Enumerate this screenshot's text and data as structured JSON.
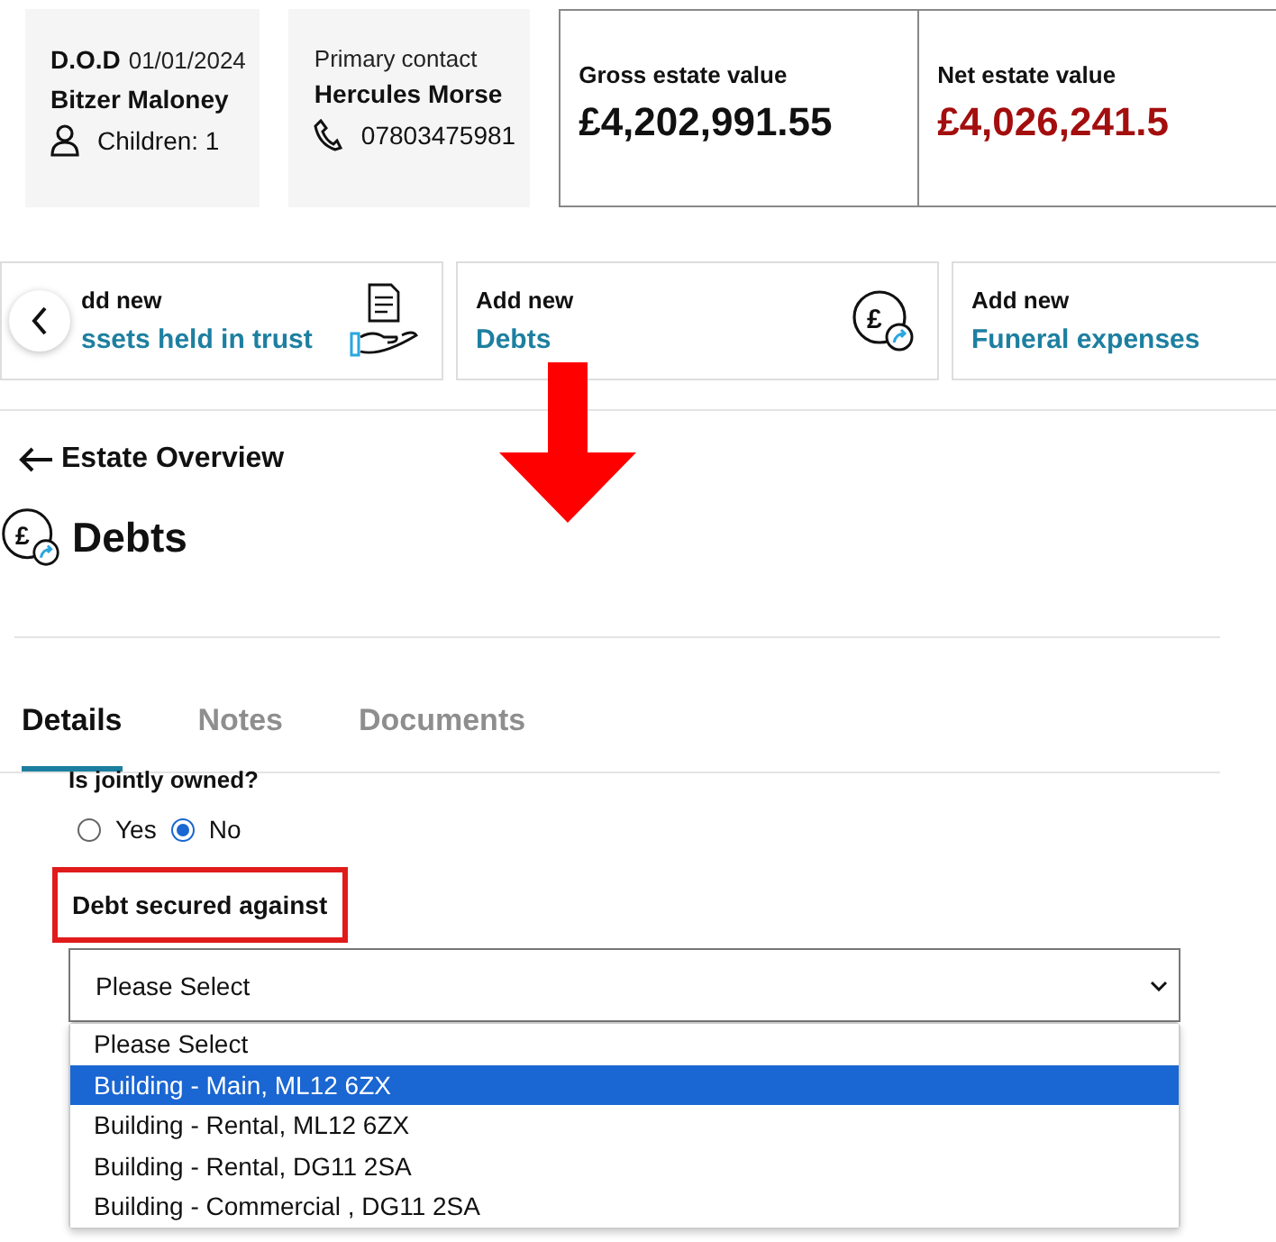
{
  "summary_cards": [
    {
      "kind": "person",
      "label": "D.O.D",
      "date": "01/01/2024",
      "name": "Bitzer Maloney",
      "detail": "Children: 1"
    },
    {
      "kind": "contact",
      "label": "Primary contact",
      "name": "Hercules Morse",
      "detail": "07803475981"
    }
  ],
  "value_cards": [
    {
      "label": "Gross estate value",
      "value": "£4,202,991.55",
      "negative": false
    },
    {
      "label": "Net estate value",
      "value": "£4,026,241.5",
      "negative": true
    }
  ],
  "add_cards": [
    {
      "kind": "trust",
      "label": "dd new",
      "link": "ssets held in trust"
    },
    {
      "kind": "debt",
      "label": "Add new",
      "link": "Debts",
      "icon_symbol": "£"
    },
    {
      "kind": "none",
      "label": "Add new",
      "link": "Funeral expenses"
    }
  ],
  "back_link": "Estate Overview",
  "page_title": "Debts",
  "page_icon_symbol": "£",
  "tabs": [
    {
      "label": "Details",
      "selected": true
    },
    {
      "label": "Notes",
      "selected": false
    },
    {
      "label": "Documents",
      "selected": false
    }
  ],
  "question": "Is jointly owned?",
  "radios": [
    {
      "label": "Yes",
      "selected": false
    },
    {
      "label": "No",
      "selected": true
    }
  ],
  "field_label": "Debt secured against",
  "select": {
    "value": "Please Select",
    "expanded": true
  },
  "options": [
    {
      "label": "Please Select",
      "selected": false
    },
    {
      "label": "Building - Main, ML12 6ZX",
      "selected": true
    },
    {
      "label": "Building - Rental, ML12 6ZX",
      "selected": false
    },
    {
      "label": "Building - Rental, DG11 2SA",
      "selected": false
    },
    {
      "label": "Building - Commercial , DG11 2SA",
      "selected": false
    }
  ]
}
